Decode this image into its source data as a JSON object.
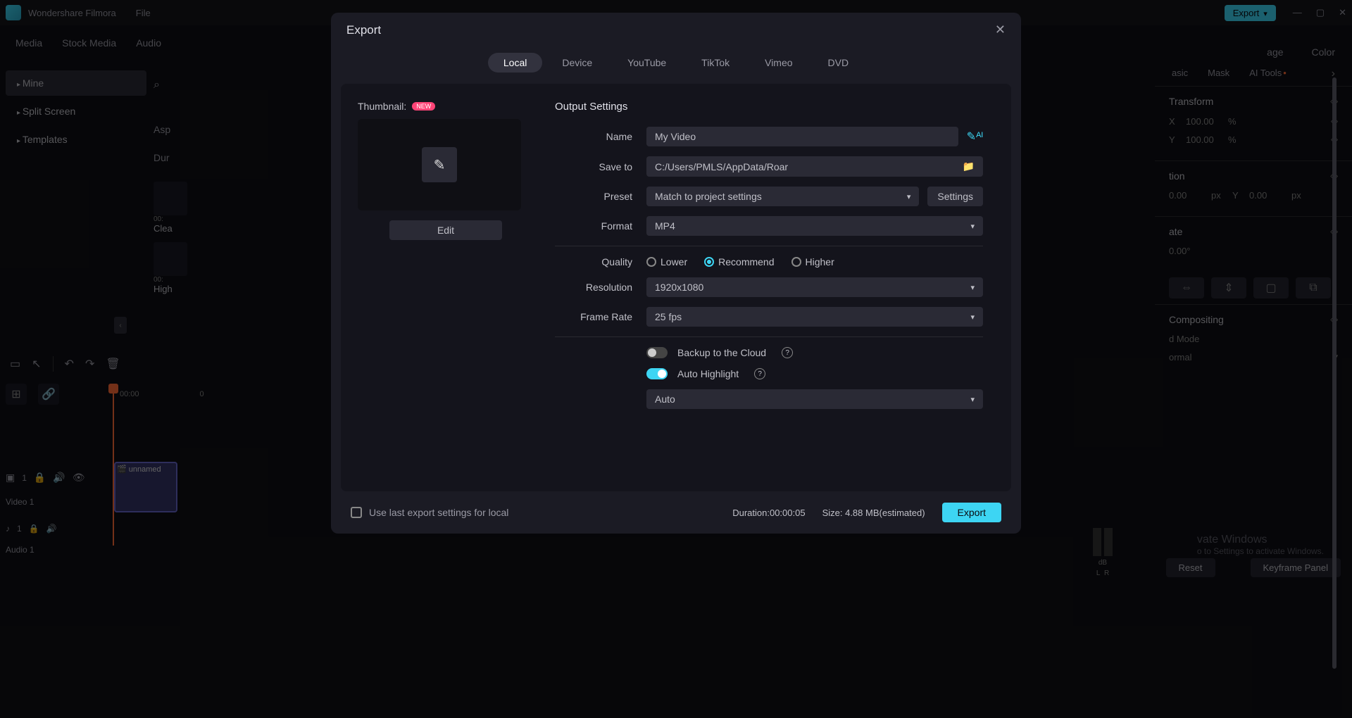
{
  "app": {
    "name": "Wondershare Filmora",
    "file_menu": "File",
    "export_button": "Export"
  },
  "main_tabs": {
    "media": "Media",
    "stock": "Stock Media",
    "audio": "Audio"
  },
  "sidebar": {
    "mine": "Mine",
    "split": "Split Screen",
    "templates": "Templates"
  },
  "filters": {
    "aspect_prefix": "Asp",
    "duration_prefix": "Dur"
  },
  "clips": {
    "c1_ts": "00:",
    "c1_label": "Clea",
    "c2_ts": "00:",
    "c2_label": "High"
  },
  "timeline": {
    "ruler_start": "00:00",
    "ruler_next": "0",
    "clip_name": "unnamed",
    "video_track": "Video 1",
    "audio_track": "Audio 1",
    "track_v_num": "1",
    "track_a_num": "1"
  },
  "right": {
    "tab_page": "age",
    "tab_color": "Color",
    "sub_basic": "asic",
    "sub_mask": "Mask",
    "sub_ai": "AI Tools",
    "transform": "Transform",
    "scale_x": "X",
    "scale_x_val": "100.00",
    "pct": "%",
    "scale_y": "Y",
    "scale_y_val": "100.00",
    "position_label": "tion",
    "pos_val_x": "0.00",
    "pos_unit": "px",
    "pos_y": "Y",
    "pos_val_y": "0.00",
    "rot_label": "ate",
    "rot_val": "0.00°",
    "compositing": "Compositing",
    "mode_label": "d Mode",
    "mode_val": "ormal",
    "reset": "Reset",
    "keyframe": "Keyframe Panel",
    "meter_db": "dB",
    "meter_l": "L",
    "meter_r": "R"
  },
  "activate": {
    "title": "vate Windows",
    "sub": "o to Settings to activate Windows."
  },
  "dialog": {
    "title": "Export",
    "tabs": [
      "Local",
      "Device",
      "YouTube",
      "TikTok",
      "Vimeo",
      "DVD"
    ],
    "thumbnail_label": "Thumbnail:",
    "new_badge": "NEW",
    "edit": "Edit",
    "output_heading": "Output Settings",
    "name_label": "Name",
    "name_value": "My Video",
    "saveto_label": "Save to",
    "saveto_value": "C:/Users/PMLS/AppData/Roar",
    "preset_label": "Preset",
    "preset_value": "Match to project settings",
    "settings_btn": "Settings",
    "format_label": "Format",
    "format_value": "MP4",
    "quality_label": "Quality",
    "q_lower": "Lower",
    "q_rec": "Recommend",
    "q_higher": "Higher",
    "resolution_label": "Resolution",
    "resolution_value": "1920x1080",
    "framerate_label": "Frame Rate",
    "framerate_value": "25 fps",
    "backup_label": "Backup to the Cloud",
    "autohi_label": "Auto Highlight",
    "auto_value": "Auto",
    "use_last": "Use last export settings for local",
    "duration": "Duration:00:00:05",
    "size": "Size: 4.88 MB(estimated)",
    "export_btn": "Export"
  }
}
